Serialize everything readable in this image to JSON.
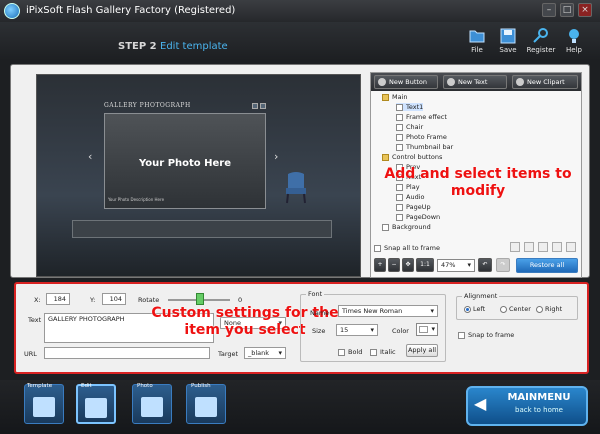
{
  "window": {
    "title": "iPixSoft Flash Gallery Factory (Registered)",
    "minimize": "–",
    "maximize": "□",
    "close": "×"
  },
  "header": {
    "step": "STEP 2",
    "step_label": "Edit template"
  },
  "toolbar": {
    "file": "File",
    "save": "Save",
    "register": "Register",
    "help": "Help"
  },
  "preview": {
    "gallery_title": "GALLERY  PHOTOGRAPH",
    "photo_text": "Your Photo Here",
    "photo_description": "Your Photo Description Here",
    "prev_arrow": "‹",
    "next_arrow": "›"
  },
  "right_panel": {
    "new_button": "New Button",
    "new_text": "New Text",
    "new_clipart": "New Clipart",
    "tree": [
      {
        "label": "Main",
        "level": 0,
        "icon": "folder-icon"
      },
      {
        "label": "Text1",
        "level": 1,
        "icon": "text-icon"
      },
      {
        "label": "Frame effect",
        "level": 1,
        "icon": "checkbox-icon"
      },
      {
        "label": "Chair",
        "level": 1,
        "icon": "checkbox-icon"
      },
      {
        "label": "Photo Frame",
        "level": 1,
        "icon": "checkbox-icon"
      },
      {
        "label": "Thumbnail bar",
        "level": 1,
        "icon": "checkbox-icon"
      },
      {
        "label": "Control buttons",
        "level": 0,
        "icon": "folder-icon"
      },
      {
        "label": "Prev",
        "level": 1,
        "icon": "button-icon"
      },
      {
        "label": "Next",
        "level": 1,
        "icon": "button-icon"
      },
      {
        "label": "Play",
        "level": 1,
        "icon": "button-icon"
      },
      {
        "label": "Audio",
        "level": 1,
        "icon": "button-icon"
      },
      {
        "label": "PageUp",
        "level": 1,
        "icon": "button-icon"
      },
      {
        "label": "PageDown",
        "level": 1,
        "icon": "button-icon"
      },
      {
        "label": "Background",
        "level": 0,
        "icon": "image-icon"
      }
    ],
    "snap_all": "Snap all to frame",
    "zoom": "47%",
    "restore_all": "Restore all",
    "overlay_text": "Add and select items to modify"
  },
  "settings": {
    "x_label": "X:",
    "x_value": "184",
    "y_label": "Y:",
    "y_value": "104",
    "rotate_label": "Rotate",
    "rotate_value": "0",
    "text_label": "Text",
    "text_value": "GALLERY  PHOTOGRAPH",
    "effect_value": "None",
    "url_label": "URL",
    "url_value": "",
    "target_label": "Target",
    "target_value": "_blank",
    "font_group": "Font",
    "font_name_label": "Name",
    "font_name": "Times New Roman",
    "size_label": "Size",
    "size_value": "15",
    "color_label": "Color",
    "color_value": "#ffffff",
    "bold": "Bold",
    "italic": "Italic",
    "apply_all": "Apply all",
    "alignment_group": "Alignment",
    "align_left": "Left",
    "align_center": "Center",
    "align_right": "Right",
    "align_selected": "Left",
    "snap_to_frame": "Snap to frame",
    "overlay_text": "Custom settings for the item you select"
  },
  "bottom_tabs": [
    {
      "label": "Template",
      "icon": "template-icon"
    },
    {
      "label": "Edit",
      "icon": "edit-icon"
    },
    {
      "label": "Photo",
      "icon": "photo-icon"
    },
    {
      "label": "Publish",
      "icon": "publish-icon"
    }
  ],
  "main_menu": {
    "title": "MAINMENU",
    "subtitle": "back to home"
  },
  "colors": {
    "accent": "#4ab4ee",
    "highlight_border": "#d82222",
    "overlay_text": "#ee1111"
  }
}
